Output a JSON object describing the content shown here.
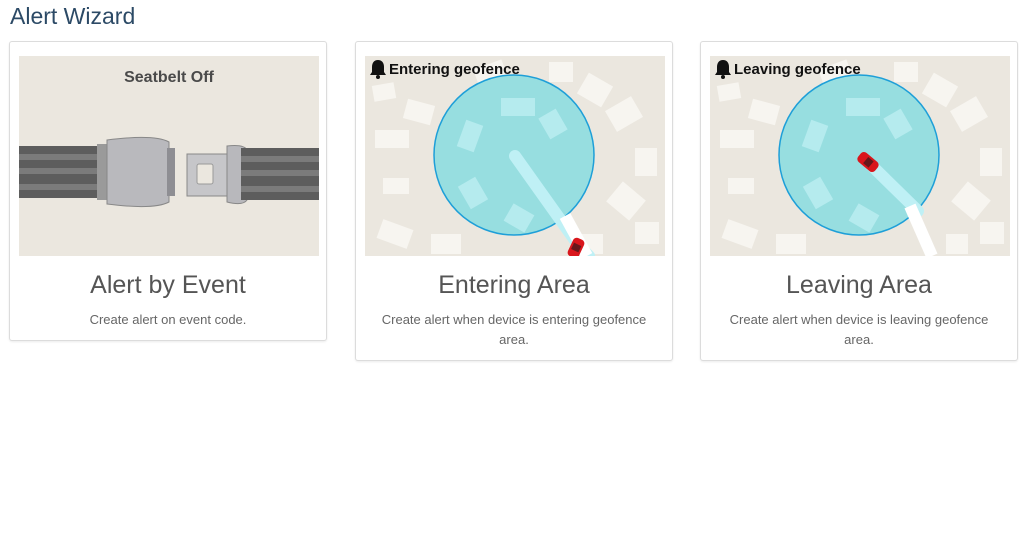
{
  "page": {
    "title": "Alert Wizard"
  },
  "cards": [
    {
      "title": "Alert by Event",
      "description": "Create alert on event code.",
      "image_caption": "Seatbelt Off"
    },
    {
      "title": "Entering Area",
      "description": "Create alert when device is entering geofence area.",
      "image_caption": "Entering geofence",
      "icon": "bell-icon"
    },
    {
      "title": "Leaving Area",
      "description": "Create alert when device is leaving geofence area.",
      "image_caption": "Leaving geofence",
      "icon": "bell-icon"
    }
  ],
  "colors": {
    "title": "#2c4a66",
    "geofence_fill": "#8fdde0",
    "geofence_stroke": "#1e9fd8",
    "map_bg": "#ebe7df",
    "car": "#d9161c"
  }
}
